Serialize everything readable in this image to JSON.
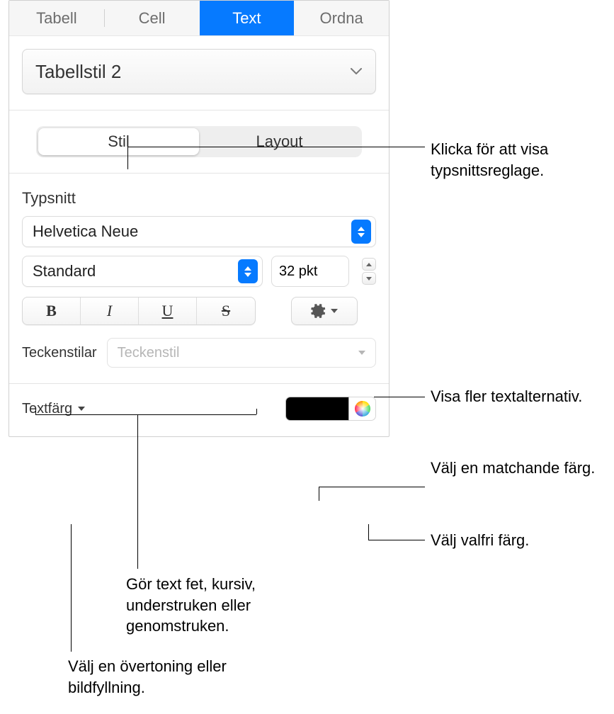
{
  "tabs": {
    "table": "Tabell",
    "cell": "Cell",
    "text": "Text",
    "arrange": "Ordna"
  },
  "para_style": "Tabellstil 2",
  "subtabs": {
    "style": "Stil",
    "layout": "Layout"
  },
  "font_section": "Typsnitt",
  "font_family": "Helvetica Neue",
  "font_weight": "Standard",
  "font_size": "32 pkt",
  "bius": {
    "bold": "B",
    "italic": "I",
    "underline": "U",
    "strike": "S"
  },
  "char_styles_label": "Teckenstilar",
  "char_styles_placeholder": "Teckenstil",
  "text_color_label": "Textfärg",
  "text_color_value": "#000000",
  "callouts": {
    "font_controls": "Klicka för att visa typsnittsreglage.",
    "more_text": "Visa fler textalternativ.",
    "match_color": "Välj en matchande färg.",
    "any_color": "Välj valfri färg.",
    "bius": "Gör text fet, kursiv, understruken eller genomstruken.",
    "gradient": "Välj en övertoning eller bildfyllning."
  }
}
